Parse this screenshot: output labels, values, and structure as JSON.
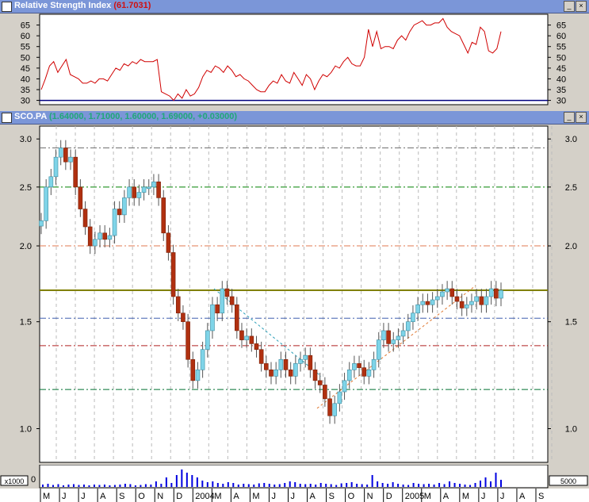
{
  "rsi_panel": {
    "title": "Relative Strength Index",
    "value": "(61.7031)",
    "yticks": [
      65,
      60,
      55,
      50,
      45,
      40,
      35,
      30
    ],
    "reference_line": 30
  },
  "price_panel": {
    "symbol": "SCO.PA",
    "ohlc_text": "(1.64000, 1.71000, 1.60000, 1.69000, +0.03000)",
    "yticks": [
      3.0,
      2.5,
      2.0,
      1.5,
      1.0
    ]
  },
  "volume_panel": {
    "unit_label": "x1000",
    "tick_label": "0",
    "right_label": "5000"
  },
  "x_axis": {
    "labels": [
      "M",
      "J",
      "J",
      "A",
      "S",
      "O",
      "N",
      "D",
      "2004",
      "M",
      "A",
      "M",
      "J",
      "J",
      "A",
      "S",
      "O",
      "N",
      "D",
      "2005",
      "M",
      "A",
      "M",
      "J",
      "J",
      "A",
      "S"
    ]
  },
  "window_buttons": {
    "minimize": "_",
    "close": "×"
  },
  "chart_data": [
    {
      "type": "line",
      "title": "Relative Strength Index",
      "ylim": [
        28,
        70
      ],
      "series": [
        {
          "name": "RSI",
          "values": [
            35,
            40,
            46,
            48,
            43,
            46,
            49,
            42,
            41,
            40,
            38,
            38,
            39,
            38,
            40,
            40,
            39,
            42,
            45,
            44,
            47,
            46,
            48,
            47,
            49,
            48,
            48,
            48,
            49,
            34,
            33,
            32,
            30,
            33,
            31,
            35,
            32,
            33,
            36,
            41,
            44,
            43,
            46,
            45,
            43,
            46,
            44,
            41,
            42,
            40,
            39,
            37,
            35,
            34,
            34,
            37,
            39,
            38,
            42,
            39,
            38,
            43,
            40,
            37,
            42,
            40,
            35,
            39,
            42,
            41,
            43,
            46,
            45,
            48,
            50,
            47,
            46,
            46,
            50,
            63,
            55,
            62,
            54,
            55,
            55,
            54,
            58,
            60,
            58,
            62,
            65,
            66,
            67,
            65,
            65,
            66,
            66,
            68,
            64,
            62,
            61,
            60,
            56,
            52,
            57,
            56,
            64,
            62,
            53,
            52,
            54,
            62
          ]
        }
      ],
      "color": "#d00000",
      "reference_line_color": "#000080"
    },
    {
      "type": "candlestick",
      "title": "SCO.PA",
      "ylim": [
        0.88,
        3.15
      ],
      "scale": "log",
      "up_color": "#7fd4e8",
      "down_color": "#b03010",
      "closes": [
        2.2,
        2.5,
        2.6,
        2.8,
        2.9,
        2.75,
        2.8,
        2.5,
        2.3,
        2.15,
        2.0,
        2.05,
        2.1,
        2.05,
        2.08,
        2.3,
        2.25,
        2.4,
        2.5,
        2.4,
        2.45,
        2.5,
        2.5,
        2.55,
        2.4,
        2.1,
        1.95,
        1.65,
        1.55,
        1.5,
        1.3,
        1.2,
        1.25,
        1.35,
        1.45,
        1.6,
        1.55,
        1.7,
        1.65,
        1.6,
        1.45,
        1.4,
        1.42,
        1.38,
        1.35,
        1.28,
        1.25,
        1.22,
        1.25,
        1.3,
        1.25,
        1.22,
        1.28,
        1.3,
        1.32,
        1.25,
        1.2,
        1.18,
        1.12,
        1.05,
        1.1,
        1.15,
        1.2,
        1.25,
        1.28,
        1.26,
        1.22,
        1.25,
        1.3,
        1.4,
        1.45,
        1.38,
        1.4,
        1.42,
        1.45,
        1.5,
        1.55,
        1.6,
        1.62,
        1.6,
        1.63,
        1.65,
        1.68,
        1.7,
        1.65,
        1.62,
        1.58,
        1.6,
        1.62,
        1.65,
        1.6,
        1.65,
        1.7,
        1.64,
        1.69
      ],
      "horizontal_levels": [
        {
          "value": 2.9,
          "color": "#707070"
        },
        {
          "value": 2.5,
          "color": "#008000"
        },
        {
          "value": 2.0,
          "color": "#e07850"
        },
        {
          "value": 1.69,
          "color": "#808000"
        },
        {
          "value": 1.52,
          "color": "#4060b0"
        },
        {
          "value": 1.37,
          "color": "#b02020"
        },
        {
          "value": 1.16,
          "color": "#007030"
        }
      ]
    },
    {
      "type": "bar",
      "title": "Volume",
      "values": [
        300,
        400,
        250,
        350,
        200,
        300,
        350,
        250,
        300,
        200,
        300,
        250,
        300,
        200,
        250,
        300,
        400,
        350,
        200,
        250,
        350,
        300,
        700,
        400,
        1200,
        500,
        1500,
        2200,
        1800,
        1500,
        1200,
        800,
        600,
        700,
        500,
        400,
        600,
        500,
        300,
        400,
        350,
        300,
        450,
        500,
        400,
        300,
        350,
        500,
        700,
        600,
        400,
        350,
        400,
        300,
        500,
        400,
        350,
        250,
        450,
        500,
        600,
        400,
        350,
        300,
        1500,
        700,
        500,
        400,
        600,
        400,
        300,
        250,
        500,
        400,
        350,
        400,
        300,
        500,
        350,
        700,
        500,
        400,
        300,
        250,
        500,
        800,
        1200,
        700,
        1800,
        900
      ],
      "color": "#0000e0"
    }
  ]
}
